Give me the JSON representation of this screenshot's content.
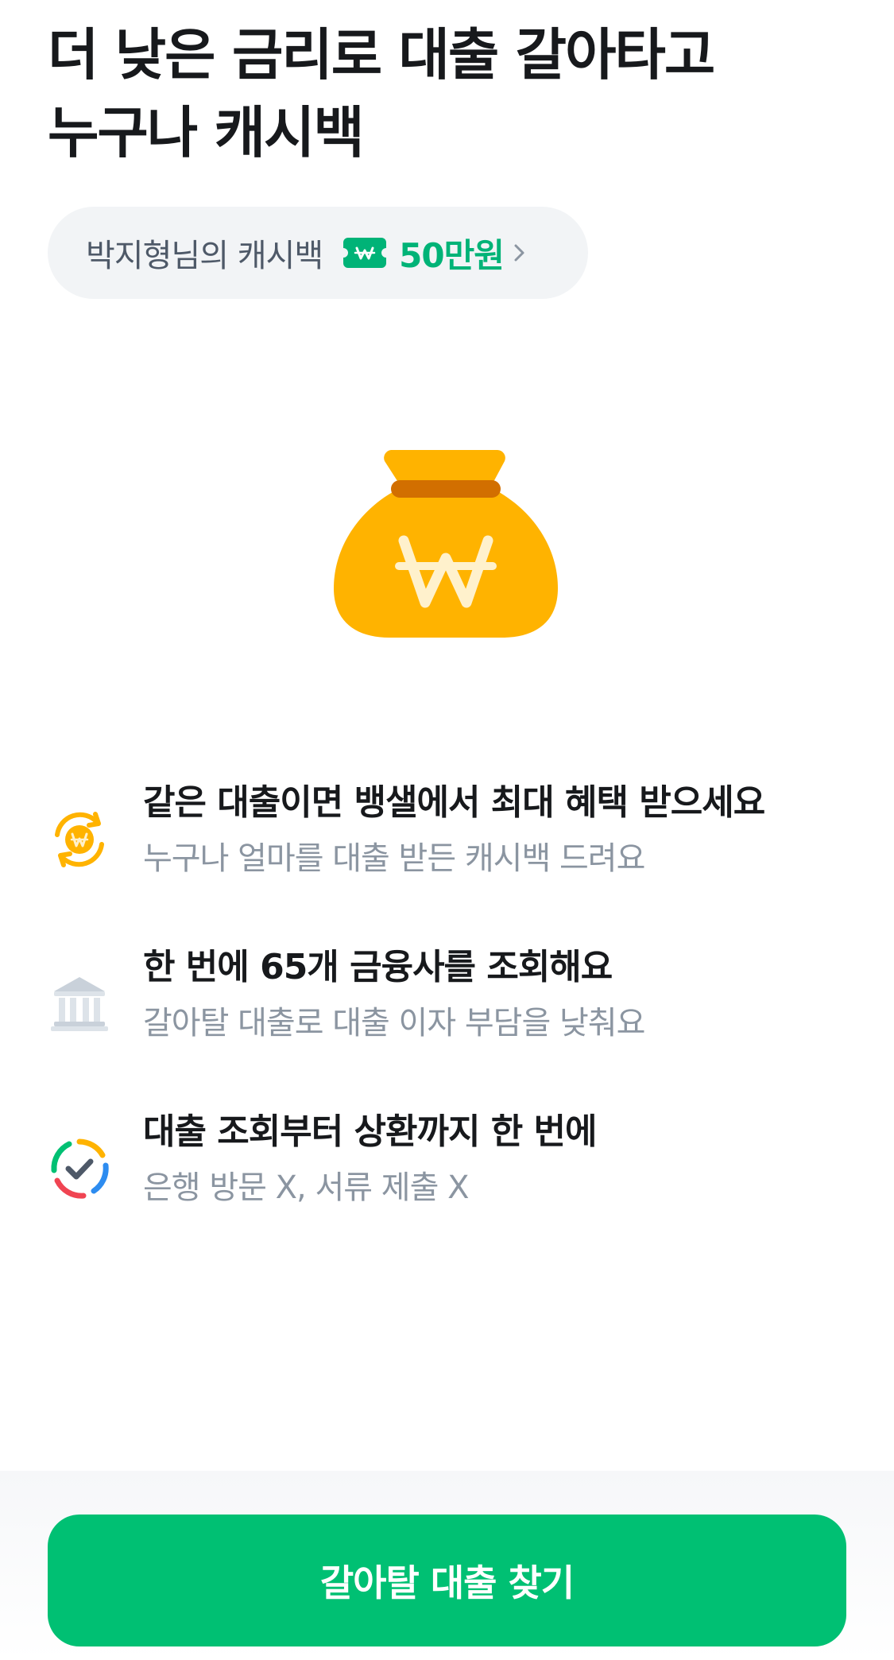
{
  "header": {
    "title_line1": "더 낮은 금리로 대출 갈아타고",
    "title_line2": "누구나 캐시백"
  },
  "cashback_chip": {
    "label": "박지형님의 캐시백",
    "amount": "50만원",
    "icon": "ticket-won-icon",
    "chevron": "chevron-right-icon"
  },
  "hero": {
    "icon": "money-bag-icon"
  },
  "features": [
    {
      "icon": "won-exchange-icon",
      "title": "같은 대출이면 뱅샐에서 최대 혜택 받으세요",
      "desc": "누구나 얼마를 대출 받든 캐시백 드려요"
    },
    {
      "icon": "bank-icon",
      "title": "한 번에 65개 금융사를 조회해요",
      "desc": "갈아탈 대출로 대출 이자 부담을 낮춰요"
    },
    {
      "icon": "check-cycle-icon",
      "title": "대출 조회부터 상환까지 한 번에",
      "desc": "은행 방문 X, 서류 제출 X"
    }
  ],
  "cta": {
    "label": "갈아탈 대출 찾기"
  },
  "colors": {
    "accent_green": "#00c073",
    "amount_green": "#00b377",
    "bag_yellow": "#ffb300",
    "text_primary": "#17191c",
    "text_secondary": "#8b95a1"
  }
}
